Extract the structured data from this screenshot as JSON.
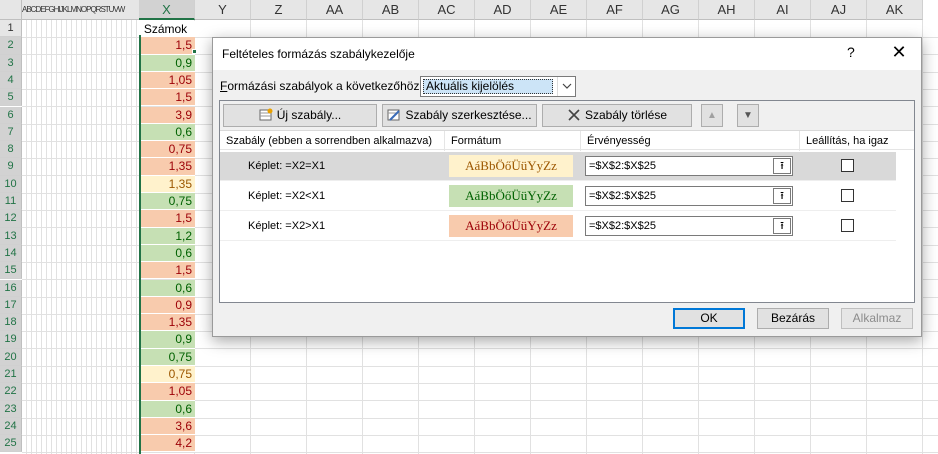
{
  "sheet": {
    "squeezed_headers": "ABCDEFGHIJKLMNOPQRSTUVW",
    "columns": [
      "X",
      "Y",
      "Z",
      "AA",
      "AB",
      "AC",
      "AD",
      "AE",
      "AF",
      "AG",
      "AH",
      "AI",
      "AJ",
      "AK"
    ],
    "rows": [
      "1",
      "2",
      "3",
      "4",
      "5",
      "6",
      "7",
      "8",
      "9",
      "10",
      "11",
      "12",
      "13",
      "14",
      "15",
      "16",
      "17",
      "18",
      "19",
      "20",
      "21",
      "22",
      "23",
      "24",
      "25"
    ],
    "header_cell": "Számok",
    "cells": [
      {
        "v": "1,5",
        "c": "red"
      },
      {
        "v": "0,9",
        "c": "green"
      },
      {
        "v": "1,05",
        "c": "red"
      },
      {
        "v": "1,5",
        "c": "red"
      },
      {
        "v": "3,9",
        "c": "red"
      },
      {
        "v": "0,6",
        "c": "green"
      },
      {
        "v": "0,75",
        "c": "red"
      },
      {
        "v": "1,35",
        "c": "red"
      },
      {
        "v": "1,35",
        "c": "yellow"
      },
      {
        "v": "0,75",
        "c": "green"
      },
      {
        "v": "1,5",
        "c": "red"
      },
      {
        "v": "1,2",
        "c": "green"
      },
      {
        "v": "0,6",
        "c": "green"
      },
      {
        "v": "1,5",
        "c": "red"
      },
      {
        "v": "0,6",
        "c": "green"
      },
      {
        "v": "0,9",
        "c": "red"
      },
      {
        "v": "1,35",
        "c": "red"
      },
      {
        "v": "0,9",
        "c": "green"
      },
      {
        "v": "0,75",
        "c": "green"
      },
      {
        "v": "0,75",
        "c": "yellow"
      },
      {
        "v": "1,05",
        "c": "red"
      },
      {
        "v": "0,6",
        "c": "green"
      },
      {
        "v": "3,6",
        "c": "red"
      },
      {
        "v": "4,2",
        "c": "red"
      }
    ]
  },
  "dialog": {
    "title": "Feltételes formázás szabálykezelője",
    "help": "?",
    "close": "✕",
    "for_label_u": "F",
    "for_label_rest": "ormázási szabályok a következőhöz:",
    "for_value": "Aktuális kijelölés",
    "toolbar": {
      "new_rule": "Új szabály...",
      "edit_rule": "Szabály szerkesztése...",
      "delete_rule": "Szabály törlése",
      "up": "▲",
      "down": "▼"
    },
    "columns": {
      "rule": "Szabály (ebben a sorrendben alkalmazva)",
      "format": "Formátum",
      "applies": "Érvényesség",
      "stop": "Leállítás, ha igaz"
    },
    "rules": [
      {
        "formula": "Képlet: =X2=X1",
        "preview": "AáBbÖőÜüYyZz",
        "style": "yellow",
        "range": "=$X$2:$X$25",
        "range_btn": "⭱"
      },
      {
        "formula": "Képlet: =X2<X1",
        "preview": "AáBbÖőÜüYyZz",
        "style": "green",
        "range": "=$X$2:$X$25",
        "range_btn": "⭱"
      },
      {
        "formula": "Képlet: =X2>X1",
        "preview": "AáBbÖőÜüYyZz",
        "style": "red",
        "range": "=$X$2:$X$25",
        "range_btn": "⭱"
      }
    ],
    "buttons": {
      "ok": "OK",
      "close": "Bezárás",
      "apply": "Alkalmaz"
    }
  }
}
